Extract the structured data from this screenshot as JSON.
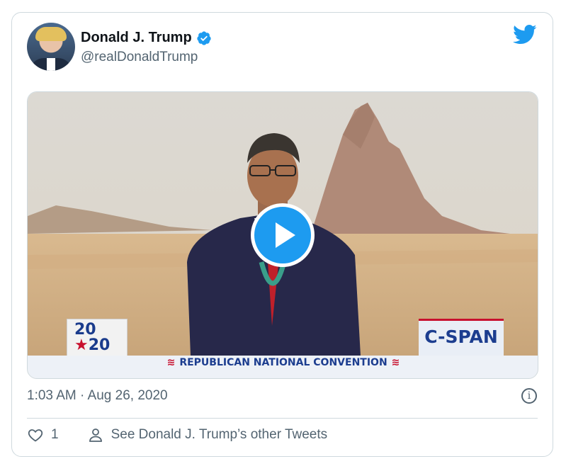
{
  "author": {
    "display_name": "Donald J. Trump",
    "handle": "@realDonaldTrump"
  },
  "media": {
    "overlay_left_logo_top": "20",
    "overlay_left_logo_bottom": "20",
    "overlay_right_logo": "C-SPAN",
    "banner_text": "REPUBLICAN NATIONAL CONVENTION"
  },
  "tweet": {
    "timestamp": "1:03 AM · Aug 26, 2020"
  },
  "actions": {
    "like_count": "1",
    "other_tweets_label": "See Donald J. Trump’s other Tweets"
  },
  "colors": {
    "accent": "#1d9bf0",
    "secondary_text": "#536471",
    "border": "#cfd9de"
  },
  "icons": {
    "verified": "verified-badge-icon",
    "brand": "twitter-bird-icon",
    "info": "info-icon",
    "like": "heart-icon",
    "profile": "person-icon",
    "play": "play-icon"
  }
}
